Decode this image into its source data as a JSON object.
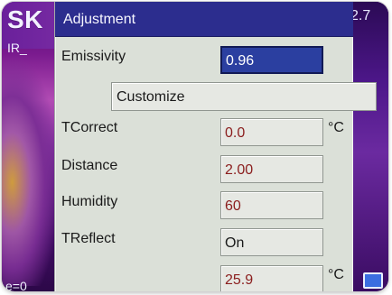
{
  "background": {
    "brand": "SK",
    "version": "2.7",
    "side_label": "IR_",
    "bottom_text": "e=0",
    "corner_icon": "window-icon"
  },
  "dialog": {
    "title": "Adjustment",
    "rows": {
      "emissivity": {
        "label": "Emissivity",
        "value": "0.96"
      },
      "customize": {
        "label": "Customize"
      },
      "tcorrect": {
        "label": "TCorrect",
        "value": "0.0",
        "unit": "°C"
      },
      "distance": {
        "label": "Distance",
        "value": "2.00"
      },
      "humidity": {
        "label": "Humidity",
        "value": "60"
      },
      "treflect": {
        "label": "TReflect",
        "value": "On"
      },
      "treflect_temp": {
        "value": "25.9",
        "unit": "°C"
      }
    }
  },
  "colors": {
    "dialog_title_bg": "#2c2d8e",
    "active_field_bg": "#2b3fa0",
    "field_value_red": "#8b1e1e"
  }
}
